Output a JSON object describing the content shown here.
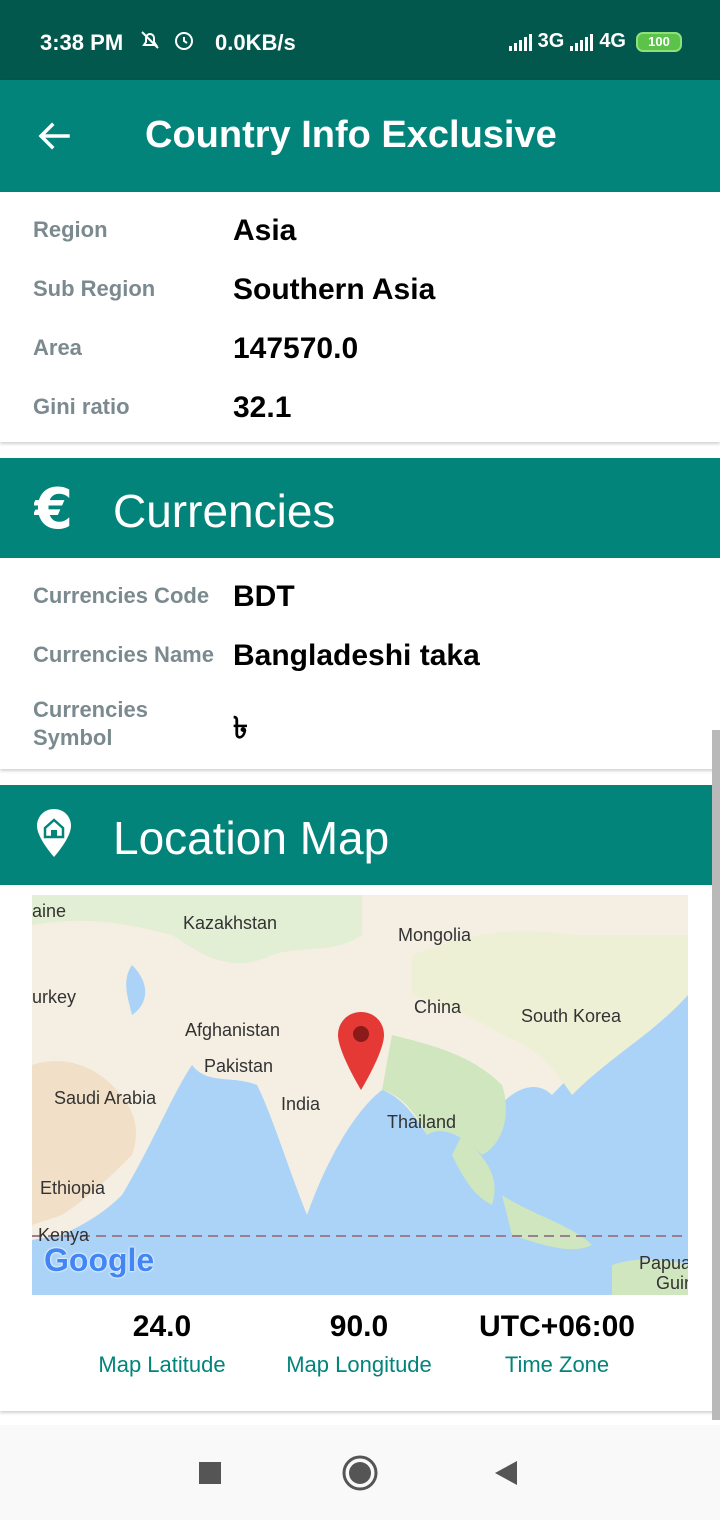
{
  "status_bar": {
    "time": "3:38 PM",
    "speed": "0.0KB/s",
    "network1": "3G",
    "network2": "4G",
    "battery": "100"
  },
  "app_bar": {
    "title": "Country Info Exclusive"
  },
  "general": {
    "rows": [
      {
        "label": "Region",
        "value": "Asia"
      },
      {
        "label": "Sub Region",
        "value": "Southern Asia"
      },
      {
        "label": "Area",
        "value": "147570.0"
      },
      {
        "label": "Gini ratio",
        "value": "32.1"
      }
    ]
  },
  "currencies": {
    "header": "Currencies",
    "rows": [
      {
        "label": "Currencies Code",
        "value": "BDT"
      },
      {
        "label": "Currencies Name",
        "value": "Bangladeshi taka"
      },
      {
        "label": "Currencies Symbol",
        "value": "৳"
      }
    ]
  },
  "location": {
    "header": "Location Map",
    "map_labels": [
      "aine",
      "Kazakhstan",
      "Mongolia",
      "urkey",
      "China",
      "South Korea",
      "Afghanistan",
      "Pakistan",
      "Saudi Arabia",
      "India",
      "Thailand",
      "Ethiopia",
      "Kenya",
      "Papua",
      "Guir"
    ],
    "google": "Google",
    "latitude": "24.0",
    "latitude_label": "Map Latitude",
    "longitude": "90.0",
    "longitude_label": "Map Longitude",
    "timezone": "UTC+06:00",
    "timezone_label": "Time Zone"
  },
  "colors": {
    "status_bar": "#02584d",
    "primary": "#02847a",
    "label_gray": "#7b8a8f",
    "pin_red": "#e53935"
  },
  "icons": [
    "back-arrow-icon",
    "euro-icon",
    "location-home-icon",
    "stop-square-icon",
    "home-circle-icon",
    "back-triangle-icon"
  ]
}
